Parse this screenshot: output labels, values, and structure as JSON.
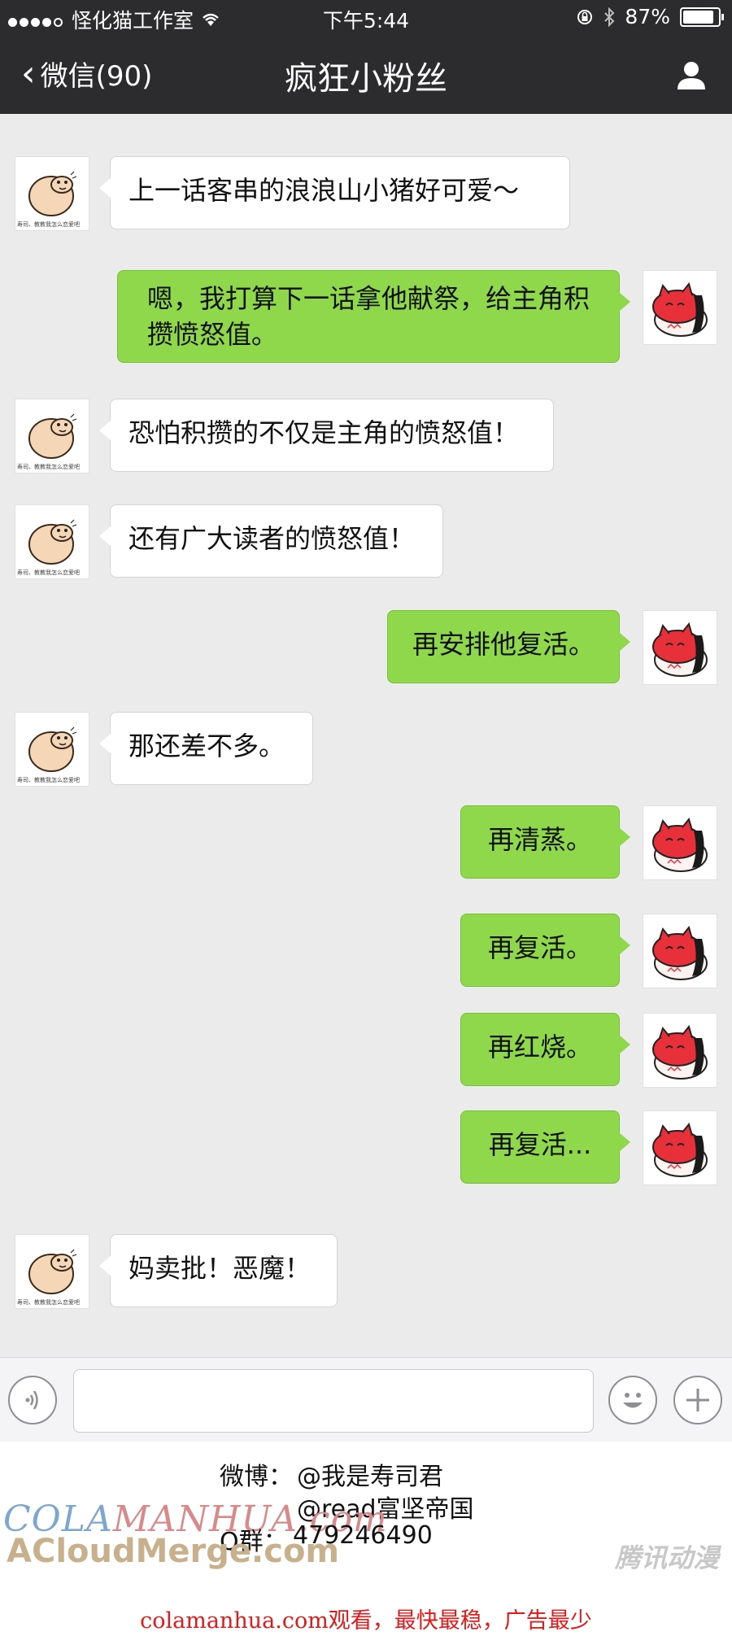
{
  "status_bar": {
    "carrier": "怪化猫工作室",
    "time": "下午5:44",
    "battery": "87%",
    "battery_level": 0.87
  },
  "nav": {
    "back_label": "微信(90)",
    "title": "疯狂小粉丝"
  },
  "avatars": {
    "incoming_caption": "寿司、教教我怎么恋爱吧"
  },
  "messages": [
    {
      "side": "in",
      "text": "上一话客串的浪浪山小猪好可爱～"
    },
    {
      "side": "out",
      "text": "嗯，我打算下一话拿他献祭，给主角积攒愤怒值。"
    },
    {
      "side": "in",
      "text": "恐怕积攒的不仅是主角的愤怒值！"
    },
    {
      "side": "in",
      "text": "还有广大读者的愤怒值！"
    },
    {
      "side": "out",
      "text": "再安排他复活。"
    },
    {
      "side": "in",
      "text": "那还差不多。"
    },
    {
      "side": "out",
      "text": "再清蒸。"
    },
    {
      "side": "out",
      "text": "再复活。"
    },
    {
      "side": "out",
      "text": "再红烧。"
    },
    {
      "side": "out",
      "text": "再复活..."
    },
    {
      "side": "in",
      "text": "妈卖批！恶魔！"
    }
  ],
  "input_bar": {
    "placeholder": ""
  },
  "footer": {
    "weibo_label": "微博：",
    "weibo_1": "@我是寿司君",
    "weibo_2": "@read富坚帝国",
    "qq_label": "Q群：",
    "qq_number": "479246490",
    "watermark_1a": "COLA",
    "watermark_1b": "MANHUA.com",
    "watermark_2": "ACloudMerge.com",
    "watermark_3": "腾讯动漫",
    "ad": "colamanhua.com观看，最快最稳，广告最少"
  }
}
